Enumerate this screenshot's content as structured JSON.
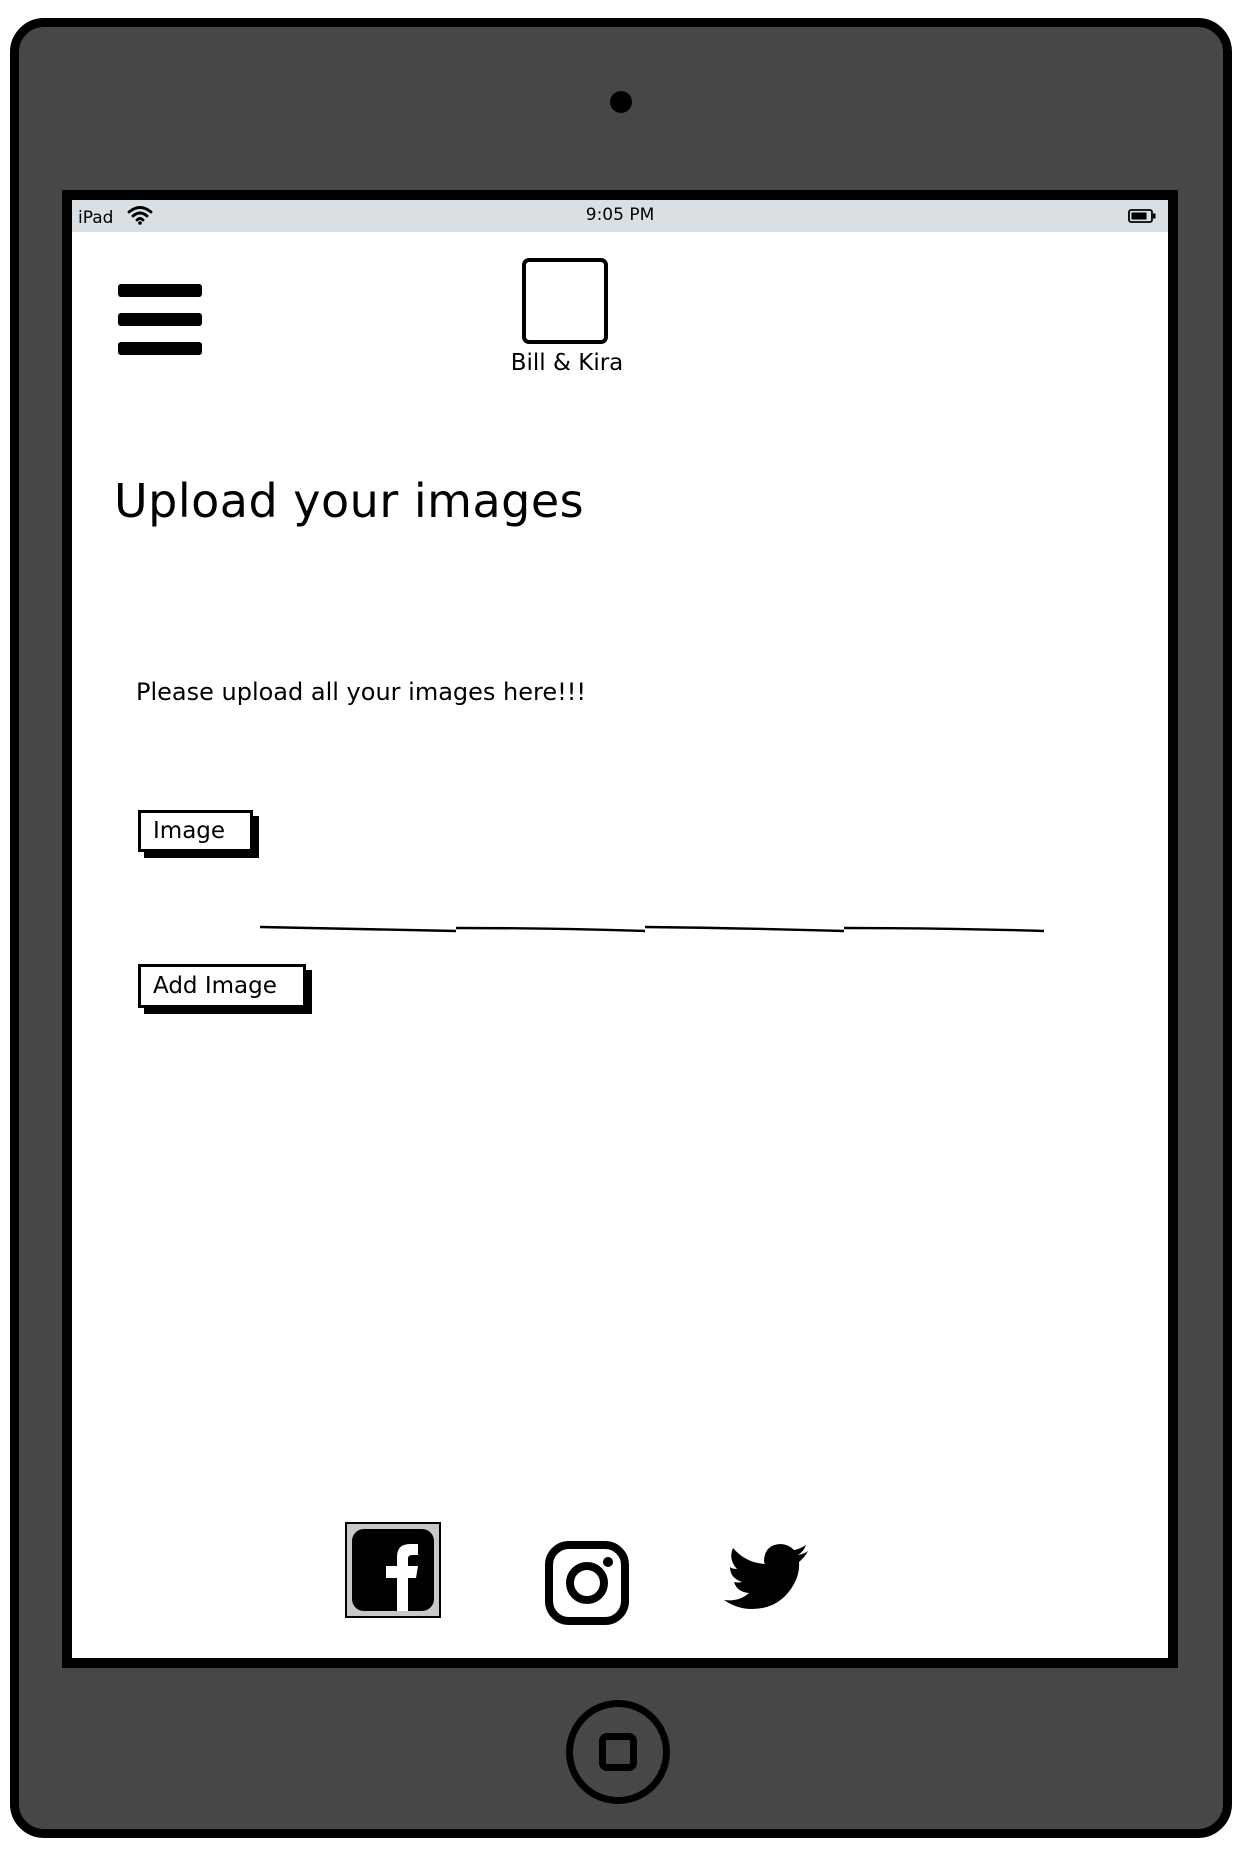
{
  "status_bar": {
    "device": "iPad",
    "time": "9:05 PM",
    "wifi_icon": "wifi-icon",
    "battery_icon": "battery-icon"
  },
  "header": {
    "menu_icon": "hamburger-menu-icon",
    "logo_caption": "Bill & Kira"
  },
  "main": {
    "title": "Upload your images",
    "intro": "Please upload all your images here!!!",
    "image_button_label": "Image",
    "upload_field_value": "",
    "add_image_button_label": "Add Image"
  },
  "footer": {
    "social_icons": [
      "facebook-icon",
      "instagram-icon",
      "twitter-icon"
    ]
  },
  "colors": {
    "device_body": "#474747",
    "status_bar": "#d9dfe2",
    "facebook_background": "#c8c8c8"
  }
}
